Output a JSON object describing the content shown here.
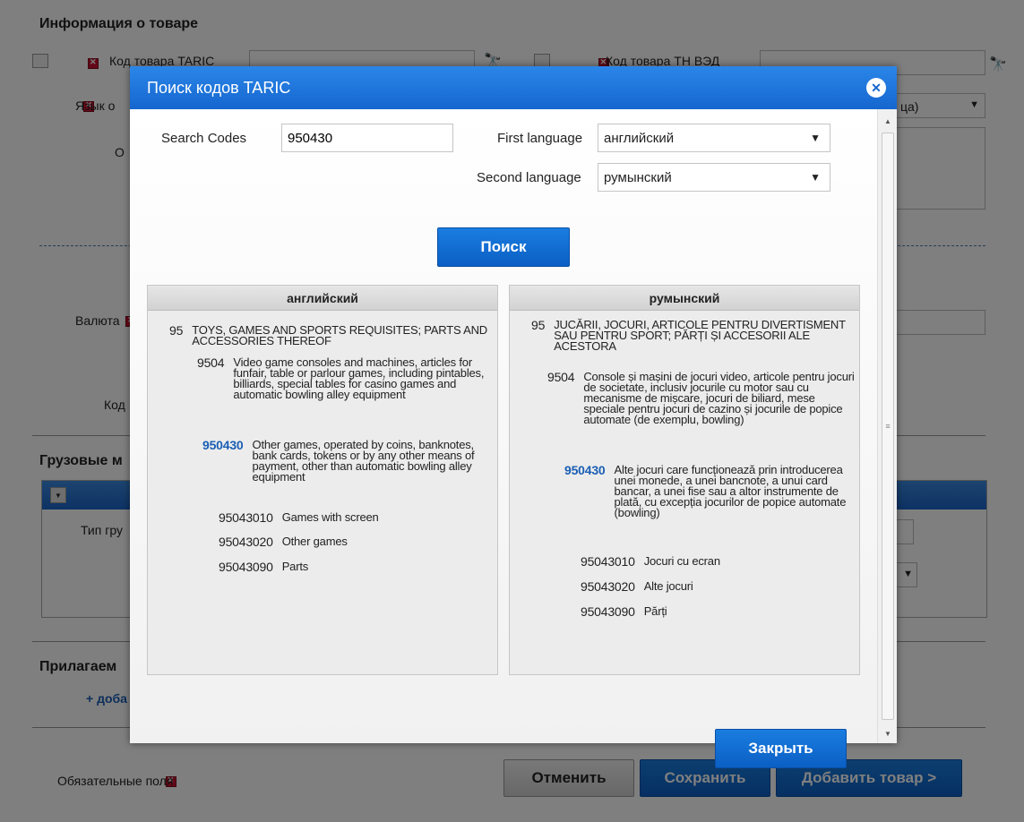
{
  "background": {
    "section_product": "Информация о товаре",
    "taric_label": "Код товара TARIC",
    "tnved_label": "Код товара ТН ВЭД",
    "language_label": "Язык о",
    "language_value_suffix": "ца)",
    "o_label": "О",
    "currency_label": "Валюта",
    "code_label": "Код",
    "section_cargo": "Грузовые м",
    "cargo_type_label": "Тип гру",
    "section_attached": "Прилагаем",
    "add_link": "+ доба",
    "required_fields": "Обязательные поля",
    "cancel_button": "Отменить",
    "save_button": "Сохранить",
    "add_product_button": "Добавить товар >"
  },
  "modal": {
    "title": "Поиск кодов TARIC",
    "search_label": "Search Codes",
    "search_value": "950430",
    "first_language_label": "First language",
    "first_language_value": "английский",
    "second_language_label": "Second language",
    "second_language_value": "румынский",
    "search_button": "Поиск",
    "close_button": "Закрыть"
  },
  "results": {
    "left": {
      "header": "английский",
      "entries": [
        {
          "code": "95",
          "text": "TOYS, GAMES AND SPORTS REQUISITES; PARTS AND ACCESSORIES THEREOF"
        },
        {
          "code": "9504",
          "text": "Video game consoles and machines, articles for funfair, table or parlour games, including pintables, billiards, special tables for casino games and automatic bowling alley equipment"
        },
        {
          "code": "950430",
          "text": "Other games, operated by coins, banknotes, bank cards, tokens or by any other means of payment, other than automatic bowling alley equipment"
        },
        {
          "code": "95043010",
          "text": "Games with screen"
        },
        {
          "code": "95043020",
          "text": "Other games"
        },
        {
          "code": "95043090",
          "text": "Parts"
        }
      ]
    },
    "right": {
      "header": "румынский",
      "entries": [
        {
          "code": "95",
          "text": "JUCĂRII, JOCURI, ARTICOLE PENTRU DIVERTISMENT SAU PENTRU SPORT; PĂRȚI ȘI ACCESORII ALE ACESTORA"
        },
        {
          "code": "9504",
          "text": "Console și mașini de jocuri video, articole pentru jocuri de societate, inclusiv jocurile cu motor sau cu mecanisme de mișcare, jocuri de biliard, mese speciale pentru jocuri de cazino și jocurile de popice automate (de exemplu, bowling)"
        },
        {
          "code": "950430",
          "text": "Alte jocuri care funcționează prin introducerea unei monede, a unei bancnote, a unui card bancar, a unei fise sau a altor instrumente de plată, cu excepția jocurilor de popice automate (bowling)"
        },
        {
          "code": "95043010",
          "text": "Jocuri cu ecran"
        },
        {
          "code": "95043020",
          "text": "Alte jocuri"
        },
        {
          "code": "95043090",
          "text": "Părți"
        }
      ]
    }
  },
  "colors": {
    "accent": "#1566cf",
    "highlight_code": "#1b5fb4",
    "required": "#c8102e"
  }
}
